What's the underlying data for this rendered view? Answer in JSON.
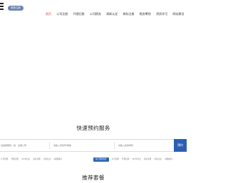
{
  "header": {
    "login_label": "登录/注册",
    "nav": [
      {
        "label": "首页",
        "active": true
      },
      {
        "label": "公司注册",
        "active": false
      },
      {
        "label": "代理记账",
        "active": false
      },
      {
        "label": "公司税务",
        "active": false
      },
      {
        "label": "高新认定",
        "active": false
      },
      {
        "label": "商标注册",
        "active": false
      },
      {
        "label": "税务筹划",
        "active": false
      },
      {
        "label": "资质许可",
        "active": false
      },
      {
        "label": "网站建设",
        "active": false
      }
    ]
  },
  "booking": {
    "title": "快速预约服务",
    "field1_placeholder": "请选择服务，如：注册公司",
    "field2_placeholder": "请输入手机号/微信",
    "field3_placeholder": "请输入您的称呼",
    "search_label": "预约"
  },
  "tags_left": [
    "公司注册",
    "代理记账",
    "ICP许可证",
    "商标注册",
    "高新认定",
    "A级纳税人"
  ],
  "tags_right": {
    "highlight": "热门服务推荐",
    "items": [
      "公司注册",
      "代理记账",
      "ICP许可证",
      "商标注册",
      "高新认定",
      "A级纳税人"
    ]
  },
  "packages": {
    "title": "推荐套餐"
  },
  "colors": {
    "accent": "#2c5fb3",
    "nav_active": "#e23a3a",
    "login_bg": "#6a84b0"
  }
}
